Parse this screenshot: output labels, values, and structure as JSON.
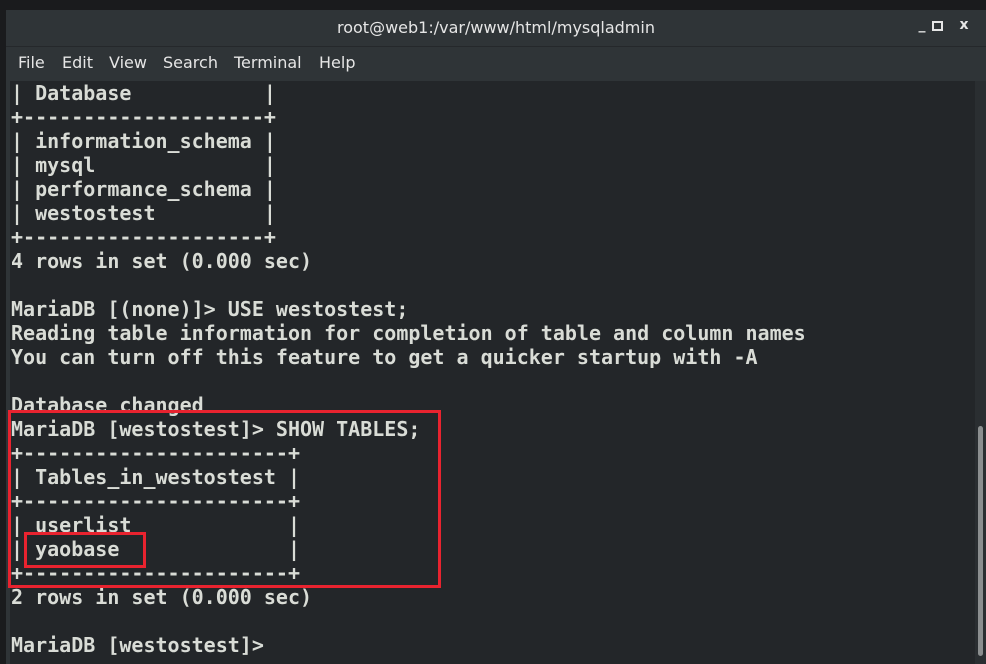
{
  "window": {
    "title": "root@web1:/var/www/html/mysqladmin",
    "minimize": "_",
    "maximize": "▫",
    "close": "x"
  },
  "menu": [
    "File",
    "Edit",
    "View",
    "Search",
    "Terminal",
    "Help"
  ],
  "terminal_lines": [
    "| Database           |",
    "+--------------------+",
    "| information_schema |",
    "| mysql              |",
    "| performance_schema |",
    "| westostest         |",
    "+--------------------+",
    "4 rows in set (0.000 sec)",
    "",
    "MariaDB [(none)]> USE westostest;",
    "Reading table information for completion of table and column names",
    "You can turn off this feature to get a quicker startup with -A",
    "",
    "Database changed",
    "MariaDB [westostest]> SHOW TABLES;",
    "+----------------------+",
    "| Tables_in_westostest |",
    "+----------------------+",
    "| userlist             |",
    "| yaobase              |",
    "+----------------------+",
    "2 rows in set (0.000 sec)",
    "",
    "MariaDB [westostest]> "
  ],
  "colors": {
    "highlight": "#e8232f",
    "terminal_bg": "#232629",
    "text": "#d9dcd6"
  }
}
